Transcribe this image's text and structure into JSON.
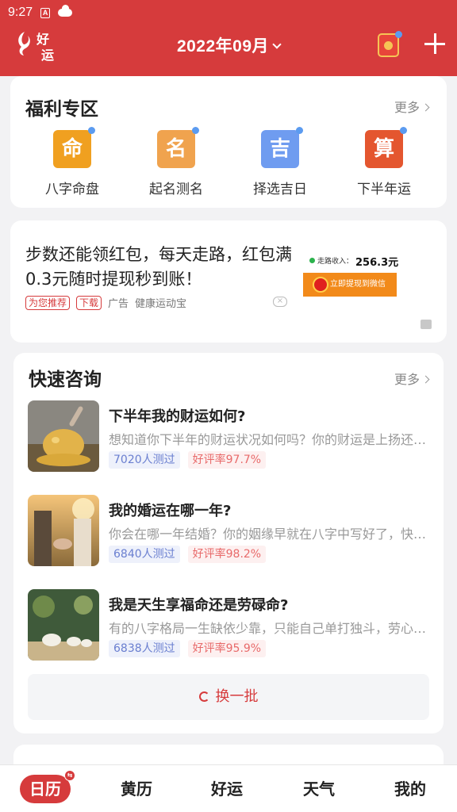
{
  "status_bar": {
    "time": "9:27"
  },
  "header": {
    "logo_text_1": "好",
    "logo_text_2": "运",
    "month": "2022年09月"
  },
  "welfare": {
    "title": "福利专区",
    "more": "更多",
    "items": [
      {
        "icon_char": "命",
        "label": "八字命盘",
        "color": "#f0a020"
      },
      {
        "icon_char": "名",
        "label": "起名测名",
        "color": "#f0a34e"
      },
      {
        "icon_char": "吉",
        "label": "择选吉日",
        "color": "#6f9cf0"
      },
      {
        "icon_char": "算",
        "label": "下半年运",
        "color": "#e4562f"
      }
    ]
  },
  "ad": {
    "text": "步数还能领红包，每天走路，红包满0.3元随时提现秒到账！",
    "tag_recommend": "为您推荐",
    "tag_download": "下载",
    "ad_label": "广告",
    "sponsor": "健康运动宝",
    "img_label": "走路收入：",
    "img_amount": "256.3元",
    "img_button": "立即提现到微信"
  },
  "consult": {
    "title": "快速咨询",
    "more": "更多",
    "items": [
      {
        "title": "下半年我的财运如何?",
        "desc": "想知道你下半年的财运状况如何吗？你的财运是上扬还是下滑？",
        "count": "7020人测过",
        "rating": "好评率97.7%"
      },
      {
        "title": "我的婚运在哪一年?",
        "desc": "你会在哪一年结婚？你的姻缘早就在八字中写好了，快来看看吧",
        "count": "6840人测过",
        "rating": "好评率98.2%"
      },
      {
        "title": "我是天生享福命还是劳碌命?",
        "desc": "有的八字格局一生缺依少靠，只能自己单打独斗，劳心劳力",
        "count": "6838人测过",
        "rating": "好评率95.9%"
      }
    ],
    "refresh": "换一批"
  },
  "tabs": [
    {
      "label": "日历",
      "active": true
    },
    {
      "label": "黄历"
    },
    {
      "label": "好运"
    },
    {
      "label": "天气"
    },
    {
      "label": "我的"
    }
  ],
  "colors": {
    "brand_red": "#d63b3c",
    "page_bg": "#f2f2f4"
  }
}
